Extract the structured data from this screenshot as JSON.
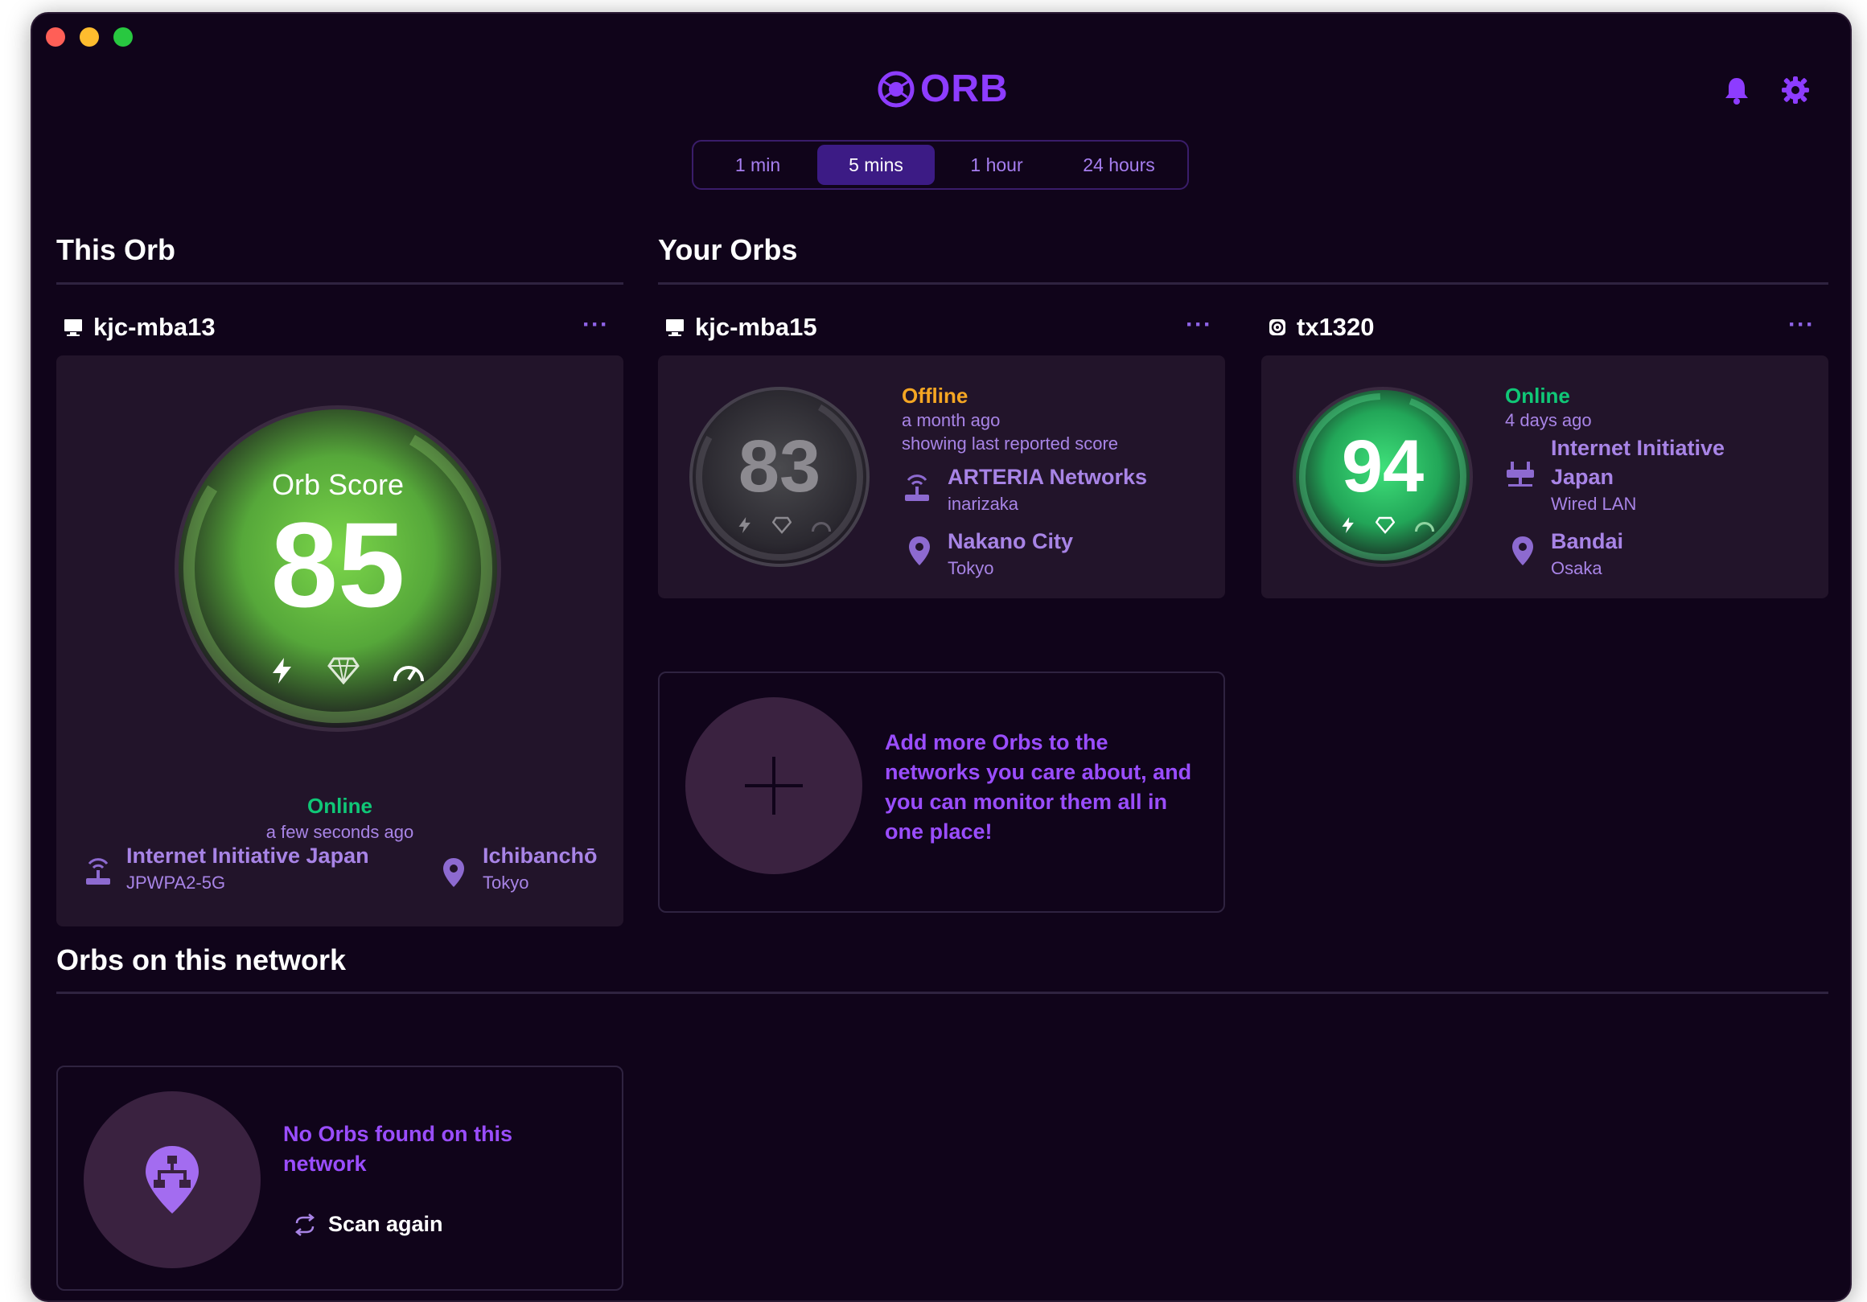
{
  "app": {
    "name": "ORB"
  },
  "timeframes": [
    {
      "label": "1 min",
      "active": false
    },
    {
      "label": "5 mins",
      "active": true
    },
    {
      "label": "1 hour",
      "active": false
    },
    {
      "label": "24 hours",
      "active": false
    }
  ],
  "this_orb": {
    "section_title": "This Orb",
    "device_name": "kjc-mba13",
    "score_label": "Orb Score",
    "score": "85",
    "status": "Online",
    "last_seen": "a few seconds ago",
    "network_name": "Internet Initiative Japan",
    "network_detail": "JPWPA2-5G",
    "location_name": "Ichibanchō",
    "location_detail": "Tokyo"
  },
  "your_orbs": {
    "section_title": "Your Orbs",
    "orbs": [
      {
        "device_name": "kjc-mba15",
        "score": "83",
        "status": "Offline",
        "last_seen": "a month ago",
        "note": "showing last reported score",
        "network_name": "ARTERIA Networks",
        "network_detail": "inarizaka",
        "location_name": "Nakano City",
        "location_detail": "Tokyo"
      },
      {
        "device_name": "tx1320",
        "score": "94",
        "status": "Online",
        "last_seen": "4 days ago",
        "network_name_line1": "Internet Initiative",
        "network_name_line2": "Japan",
        "network_detail": "Wired LAN",
        "location_name": "Bandai",
        "location_detail": "Osaka"
      }
    ],
    "add_promo_line1": "Add more Orbs to the",
    "add_promo_line2": "networks you care about, and",
    "add_promo_line3": "you can monitor them all in",
    "add_promo_line4": "one place!"
  },
  "network_orbs": {
    "section_title": "Orbs on this network",
    "empty_line1": "No Orbs found on this",
    "empty_line2": "network",
    "scan_label": "Scan again"
  },
  "colors": {
    "background": "#10041a",
    "accent": "#8d3cff",
    "online": "#10c777",
    "offline": "#f5a623",
    "card": "#22142a"
  }
}
